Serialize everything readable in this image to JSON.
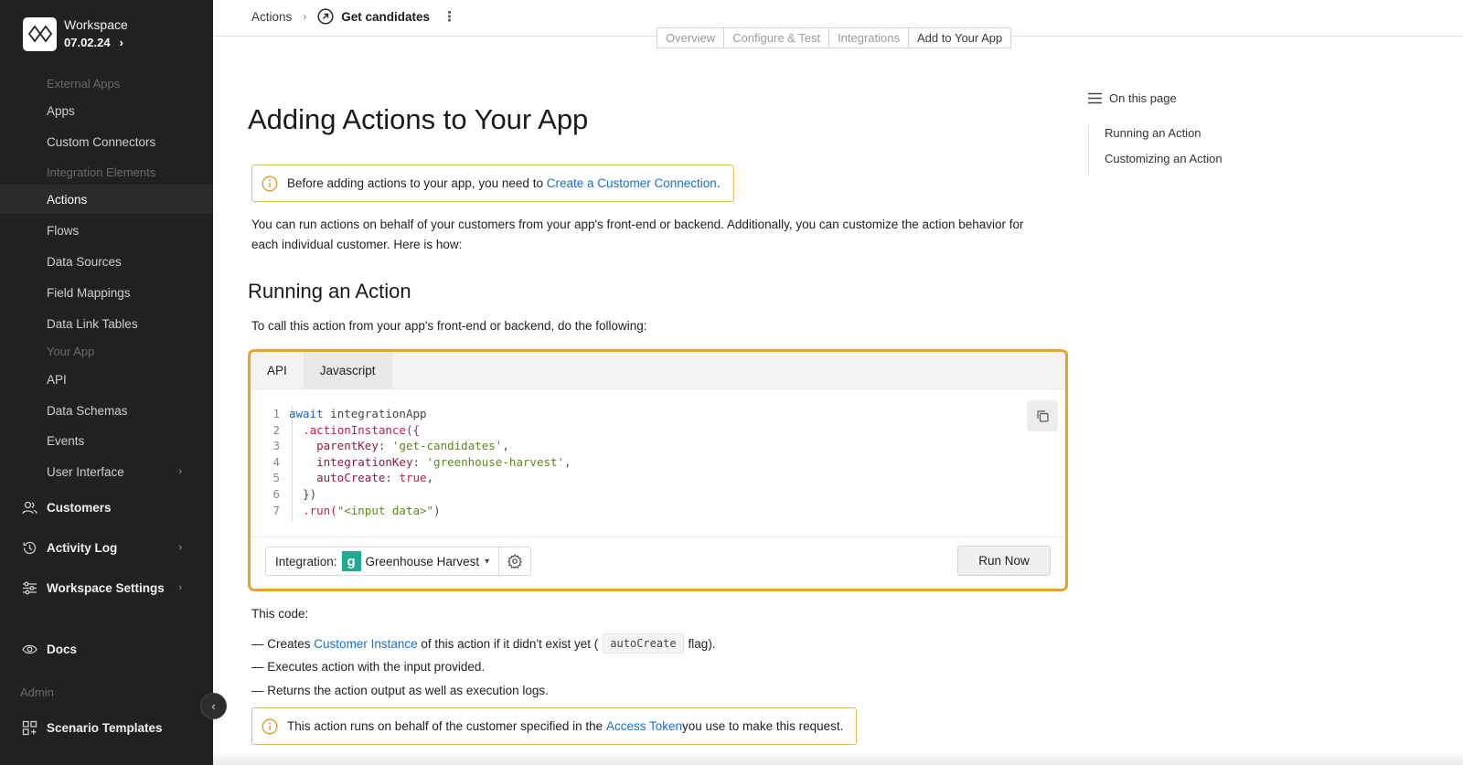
{
  "workspace": {
    "name": "Workspace",
    "date": "07.02.24"
  },
  "sidebar": {
    "sections": {
      "external_apps": "External Apps",
      "integration_elements": "Integration Elements",
      "your_app": "Your App",
      "admin": "Admin"
    },
    "external_items": [
      "Apps",
      "Custom Connectors"
    ],
    "integration_items": [
      "Actions",
      "Flows",
      "Data Sources",
      "Field Mappings",
      "Data Link Tables"
    ],
    "your_app_items": [
      "API",
      "Data Schemas",
      "Events",
      "User Interface"
    ],
    "main_items": {
      "customers": "Customers",
      "activity_log": "Activity Log",
      "workspace_settings": "Workspace Settings",
      "docs": "Docs",
      "scenario_templates": "Scenario Templates"
    },
    "active_item": "Actions"
  },
  "breadcrumb": {
    "parent": "Actions",
    "current": "Get candidates"
  },
  "tabs": [
    "Overview",
    "Configure & Test",
    "Integrations",
    "Add to Your App"
  ],
  "main": {
    "title": "Adding Actions to Your App",
    "callout1": {
      "text": "Before adding actions to your app, you need to ",
      "link": "Create a Customer Connection",
      "after": "."
    },
    "intro_line1": "You can run actions on behalf of your customers from your app's front-end or backend. Additionally, you can customize the action behavior for",
    "intro_line2": "each individual customer. Here is how:",
    "section_title": "Running an Action",
    "section_intro": "To call this action from your app's front-end or backend, do the following:",
    "code_tabs": [
      "API",
      "Javascript"
    ],
    "code": {
      "l1_kw": "await",
      "l1_rest": " integrationApp",
      "l2": ".actionInstance({",
      "l3_key": "parentKey:",
      "l3_val": "'get-candidates'",
      "l4_key": "integrationKey:",
      "l4_val": "'greenhouse-harvest'",
      "l5_key": "autoCreate:",
      "l5_val": "true",
      "l6": "})",
      "l7_fn": ".run(",
      "l7_str": "\"<input data>\"",
      "l7_end": ")"
    },
    "integration_label": "Integration:",
    "integration_value": "Greenhouse Harvest",
    "run_button": "Run Now",
    "this_code": "This code:",
    "bullet1_pre": "— Creates ",
    "bullet1_link": "Customer Instance",
    "bullet1_mid": " of this action if it didn't exist yet (",
    "bullet1_code": "autoCreate",
    "bullet1_post": " flag).",
    "bullet2": "— Executes action with the input provided.",
    "bullet3": "— Returns the action output as well as execution logs.",
    "callout2": {
      "text": "This action runs on behalf of the customer specified in the ",
      "link": "Access Token",
      "after": " you use to make this request."
    }
  },
  "toc": {
    "title": "On this page",
    "items": [
      "Running an Action",
      "Customizing an Action"
    ]
  }
}
